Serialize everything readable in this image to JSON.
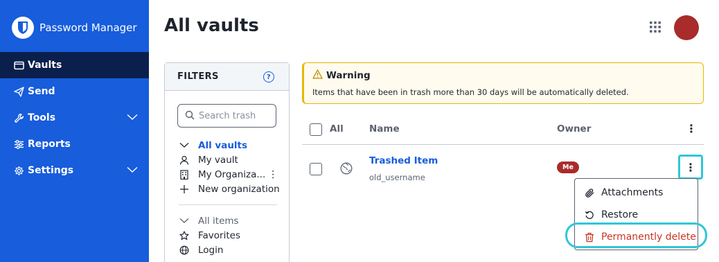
{
  "brand": {
    "name": "Password Manager"
  },
  "nav": {
    "items": [
      {
        "label": "Vaults",
        "icon": "vault-icon",
        "active": true,
        "expandable": false
      },
      {
        "label": "Send",
        "icon": "send-icon",
        "active": false,
        "expandable": false
      },
      {
        "label": "Tools",
        "icon": "wrench-icon",
        "active": false,
        "expandable": true
      },
      {
        "label": "Reports",
        "icon": "sliders-icon",
        "active": false,
        "expandable": false
      },
      {
        "label": "Settings",
        "icon": "gear-icon",
        "active": false,
        "expandable": true
      }
    ]
  },
  "header": {
    "title": "All vaults"
  },
  "filters": {
    "title": "FILTERS",
    "search_placeholder": "Search trash",
    "vaults": [
      {
        "label": "All vaults"
      },
      {
        "label": "My vault"
      },
      {
        "label": "My Organiza..."
      },
      {
        "label": "New organization"
      }
    ],
    "types": [
      {
        "label": "All items"
      },
      {
        "label": "Favorites"
      },
      {
        "label": "Login"
      }
    ]
  },
  "warning": {
    "title": "Warning",
    "text": "Items that have been in trash more than 30 days will be automatically deleted."
  },
  "table": {
    "columns": {
      "all": "All",
      "name": "Name",
      "owner": "Owner"
    },
    "rows": [
      {
        "name": "Trashed Item",
        "username": "old_username",
        "owner": "Me"
      }
    ]
  },
  "menu": {
    "items": [
      {
        "label": "Attachments"
      },
      {
        "label": "Restore"
      },
      {
        "label": "Permanently delete"
      }
    ]
  },
  "colors": {
    "sidebar": "#175ddc",
    "sidebar_active": "#0b1f4d",
    "accent": "#175ddc",
    "avatar": "#a92b2b",
    "danger": "#c83522",
    "highlight": "#30c6d9",
    "warning_border": "#e6b800"
  }
}
